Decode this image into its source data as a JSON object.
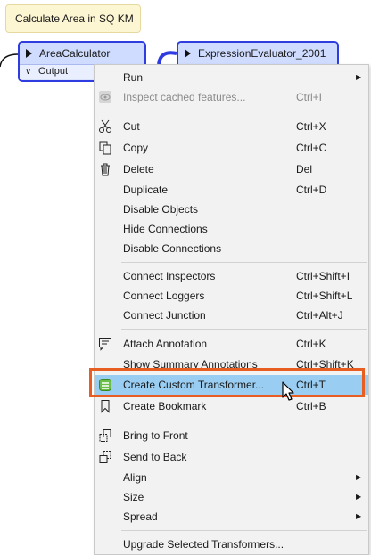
{
  "canvas": {
    "annotation_text": "Calculate Area in SQ KM",
    "node_area_calculator": {
      "title": "AreaCalculator",
      "output_port": "Output"
    },
    "node_expression_evaluator": {
      "title": "ExpressionEvaluator_2001"
    }
  },
  "context_menu": {
    "items": [
      {
        "label": "Run",
        "shortcut": "",
        "submenu": true
      },
      {
        "label": "Inspect cached features...",
        "shortcut": "Ctrl+I",
        "disabled": true
      },
      {
        "label": "Cut",
        "shortcut": "Ctrl+X"
      },
      {
        "label": "Copy",
        "shortcut": "Ctrl+C"
      },
      {
        "label": "Delete",
        "shortcut": "Del"
      },
      {
        "label": "Duplicate",
        "shortcut": "Ctrl+D"
      },
      {
        "label": "Disable Objects",
        "shortcut": ""
      },
      {
        "label": "Hide Connections",
        "shortcut": ""
      },
      {
        "label": "Disable Connections",
        "shortcut": ""
      },
      {
        "label": "Connect Inspectors",
        "shortcut": "Ctrl+Shift+I"
      },
      {
        "label": "Connect Loggers",
        "shortcut": "Ctrl+Shift+L"
      },
      {
        "label": "Connect Junction",
        "shortcut": "Ctrl+Alt+J"
      },
      {
        "label": "Attach Annotation",
        "shortcut": "Ctrl+K"
      },
      {
        "label": "Show Summary Annotations",
        "shortcut": "Ctrl+Shift+K"
      },
      {
        "label": "Create Custom Transformer...",
        "shortcut": "Ctrl+T",
        "highlighted": true
      },
      {
        "label": "Create Bookmark",
        "shortcut": "Ctrl+B"
      },
      {
        "label": "Bring to Front",
        "shortcut": ""
      },
      {
        "label": "Send to Back",
        "shortcut": ""
      },
      {
        "label": "Align",
        "shortcut": "",
        "submenu": true
      },
      {
        "label": "Size",
        "shortcut": "",
        "submenu": true
      },
      {
        "label": "Spread",
        "shortcut": "",
        "submenu": true
      },
      {
        "label": "Upgrade Selected Transformers...",
        "shortcut": ""
      }
    ]
  },
  "colors": {
    "highlight_fill": "#99cef2",
    "highlight_border": "#e85d22",
    "node_border": "#2f3de0",
    "annotation_fill": "#fdf6d3"
  }
}
